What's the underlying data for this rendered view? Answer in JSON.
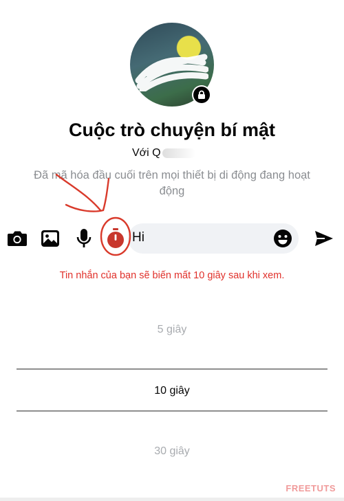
{
  "header": {
    "title": "Cuộc trò chuyện bí mật",
    "with_prefix": "Với",
    "with_name_partial": "Q",
    "encryption_notice": "Đã mã hóa đầu cuối trên mọi thiết bị di động đang hoạt động"
  },
  "composer": {
    "message_value": "Hi",
    "icons": [
      "camera-icon",
      "image-icon",
      "microphone-icon",
      "timer-icon",
      "emoji-icon",
      "send-icon"
    ]
  },
  "disappear_notice": "Tin nhắn của bạn sẽ biến mất 10 giây sau khi xem.",
  "timer_picker": {
    "options": [
      "5 giây",
      "10 giây",
      "30 giây"
    ],
    "selected": "10 giây"
  },
  "watermark": {
    "part1": "FREE",
    "part2": "TUTS"
  },
  "colors": {
    "accent_red": "#e0302a",
    "annotation_red": "#d93a2b",
    "muted_text": "#8a8d91",
    "input_bg": "#f0f2f5"
  }
}
